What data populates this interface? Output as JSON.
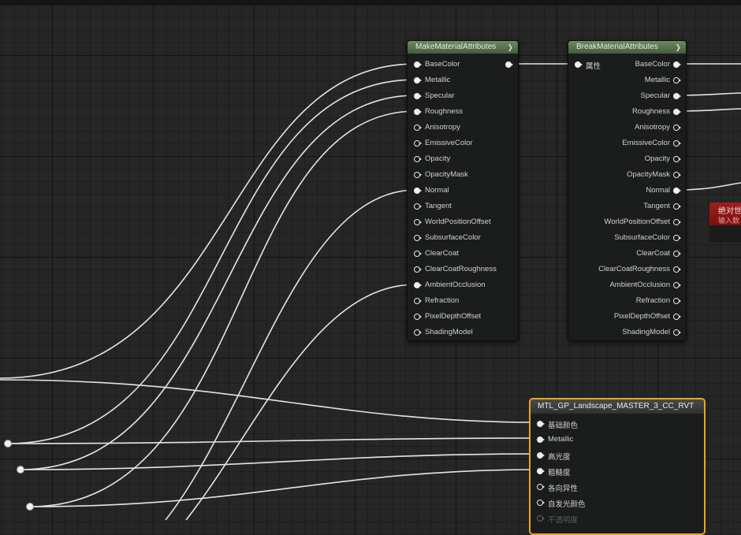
{
  "nodes": {
    "make": {
      "title": "MakeMaterialAttributes",
      "pins": [
        {
          "label": "BaseColor",
          "connected": true
        },
        {
          "label": "Metallic",
          "connected": true
        },
        {
          "label": "Specular",
          "connected": true
        },
        {
          "label": "Roughness",
          "connected": true
        },
        {
          "label": "Anisotropy",
          "connected": false
        },
        {
          "label": "EmissiveColor",
          "connected": false
        },
        {
          "label": "Opacity",
          "connected": false
        },
        {
          "label": "OpacityMask",
          "connected": false
        },
        {
          "label": "Normal",
          "connected": true
        },
        {
          "label": "Tangent",
          "connected": false
        },
        {
          "label": "WorldPositionOffset",
          "connected": false
        },
        {
          "label": "SubsurfaceColor",
          "connected": false
        },
        {
          "label": "ClearCoat",
          "connected": false
        },
        {
          "label": "ClearCoatRoughness",
          "connected": false
        },
        {
          "label": "AmbientOcclusion",
          "connected": true
        },
        {
          "label": "Refraction",
          "connected": false
        },
        {
          "label": "PixelDepthOffset",
          "connected": false
        },
        {
          "label": "ShadingModel",
          "connected": false
        }
      ]
    },
    "break": {
      "title": "BreakMaterialAttributes",
      "input_label": "属性",
      "pins": [
        {
          "label": "BaseColor",
          "connected": true
        },
        {
          "label": "Metallic",
          "connected": false
        },
        {
          "label": "Specular",
          "connected": true
        },
        {
          "label": "Roughness",
          "connected": true
        },
        {
          "label": "Anisotropy",
          "connected": false
        },
        {
          "label": "EmissiveColor",
          "connected": false
        },
        {
          "label": "Opacity",
          "connected": false
        },
        {
          "label": "OpacityMask",
          "connected": false
        },
        {
          "label": "Normal",
          "connected": true
        },
        {
          "label": "Tangent",
          "connected": false
        },
        {
          "label": "WorldPositionOffset",
          "connected": false
        },
        {
          "label": "SubsurfaceColor",
          "connected": false
        },
        {
          "label": "ClearCoat",
          "connected": false
        },
        {
          "label": "ClearCoatRoughness",
          "connected": false
        },
        {
          "label": "AmbientOcclusion",
          "connected": false
        },
        {
          "label": "Refraction",
          "connected": false
        },
        {
          "label": "PixelDepthOffset",
          "connected": false
        },
        {
          "label": "ShadingModel",
          "connected": false
        }
      ]
    },
    "error": {
      "title": "绝对世",
      "subtitle": "输入数"
    },
    "mtl": {
      "title": "MTL_GP_Landscape_MASTER_3_CC_RVT",
      "pins": [
        {
          "label": "基础颜色",
          "connected": true
        },
        {
          "label": "Metallic",
          "connected": true
        },
        {
          "label": "高光度",
          "connected": true
        },
        {
          "label": "粗糙度",
          "connected": true
        },
        {
          "label": "各向异性",
          "connected": false
        },
        {
          "label": "自发光颜色",
          "connected": false
        },
        {
          "label": "不透明度",
          "connected": false
        }
      ]
    }
  },
  "colors": {
    "grid_background": "#262626",
    "node_header_green": "#5a7a4e",
    "selection_outline": "#e5a823",
    "error_header": "#8c1818",
    "wire": "#e8e8e8"
  }
}
